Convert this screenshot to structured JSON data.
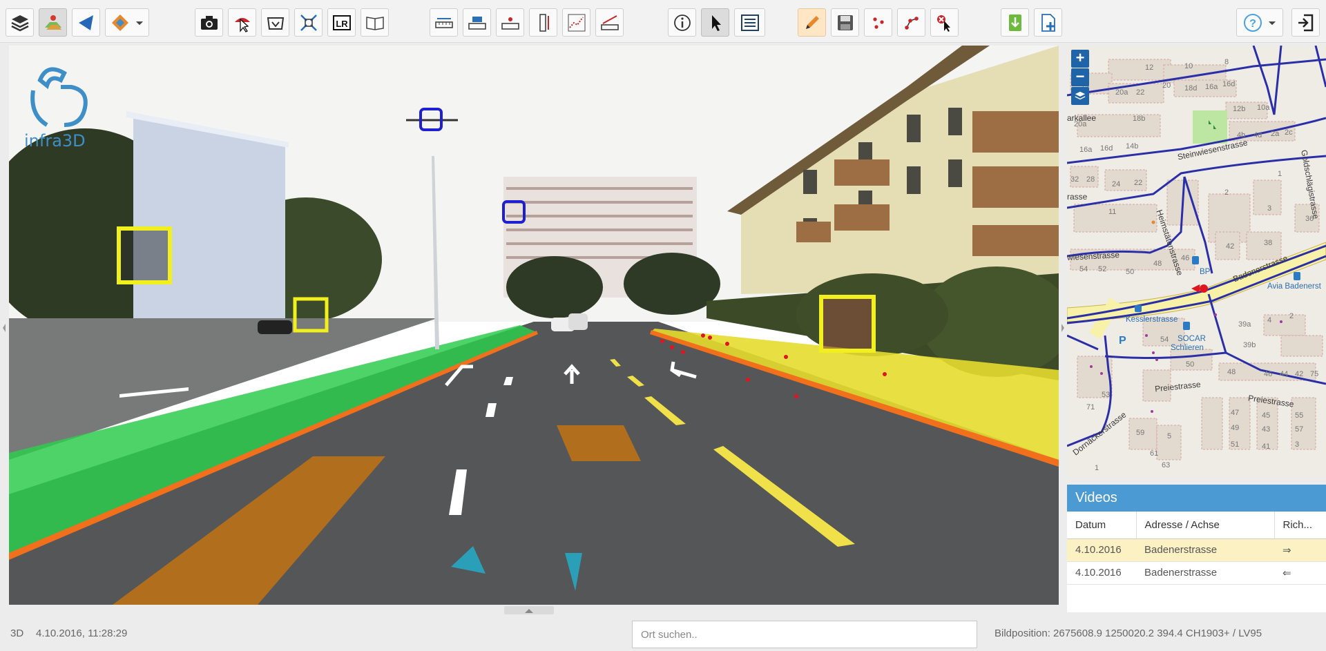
{
  "toolbar": {
    "groups": [
      [
        "layers-icon",
        "map-layers-icon",
        "triangle-nav-icon",
        "color-layer-icon",
        "dropdown-chevron-icon"
      ],
      [
        "camera-icon",
        "pointer-cloud-icon",
        "measure-frame-icon",
        "fit-extent-icon",
        "lr-toggle-icon",
        "map-book-icon"
      ],
      [
        "distance-ruler-icon",
        "height-ruler-icon",
        "point-ruler-icon",
        "vertical-ruler-icon",
        "profile-chart-icon",
        "slope-ruler-icon"
      ],
      [
        "info-icon",
        "select-arrow-icon",
        "list-icon"
      ],
      [
        "pencil-icon",
        "save-icon",
        "points-icon",
        "node-edit-icon",
        "delete-cursor-icon"
      ],
      [
        "download-icon",
        "add-document-icon"
      ],
      [
        "help-icon",
        "dropdown-chevron-icon",
        "logout-icon"
      ]
    ],
    "accent": "#4aa3df"
  },
  "viewer": {
    "logo_text": "infra3D"
  },
  "map": {
    "zoom_in": "+",
    "zoom_out": "−",
    "streets": [
      "Steinwiesenstrasse",
      "Badenerstrasse",
      "Preiestrasse",
      "Preiestrasse",
      "Dornäckerstrasse",
      "Heimstätenstrasse",
      "Goldschlägistrasse",
      "arkallee",
      "wiesenstrasse",
      "rasse"
    ],
    "pois": [
      "Kesslerstrasse",
      "SOCAR",
      "Schlieren",
      "BP",
      "Avia Badenerst"
    ],
    "house_numbers": [
      "12",
      "10",
      "8",
      "14",
      "20",
      "18d",
      "16a",
      "16d",
      "20a",
      "22",
      "12b",
      "10a",
      "20a",
      "18b",
      "4b",
      "4d",
      "2a",
      "2c",
      "16a",
      "16d",
      "14b",
      "1",
      "32",
      "28",
      "24",
      "22",
      "2",
      "3",
      "36",
      "11",
      "42",
      "38",
      "54",
      "52",
      "50",
      "48",
      "46",
      "4",
      "2",
      "39a",
      "54",
      "39b",
      "50",
      "48",
      "46",
      "44",
      "42",
      "75",
      "71",
      "53",
      "47",
      "45",
      "55",
      "49",
      "43",
      "57",
      "51",
      "41",
      "3",
      "59",
      "5",
      "61",
      "63",
      "1"
    ]
  },
  "videos": {
    "title": "Videos",
    "columns": [
      "Datum",
      "Adresse / Achse",
      "Rich..."
    ],
    "rows": [
      {
        "datum": "4.10.2016",
        "adresse": "Badenerstrasse",
        "richtung": "⇒",
        "selected": true
      },
      {
        "datum": "4.10.2016",
        "adresse": "Badenerstrasse",
        "richtung": "⇐",
        "selected": false
      }
    ]
  },
  "status": {
    "mode": "3D",
    "datetime": "4.10.2016, 11:28:29",
    "search_placeholder": "Ort suchen..",
    "position": "Bildposition: 2675608.9 1250020.2 394.4 CH1903+ / LV95"
  }
}
